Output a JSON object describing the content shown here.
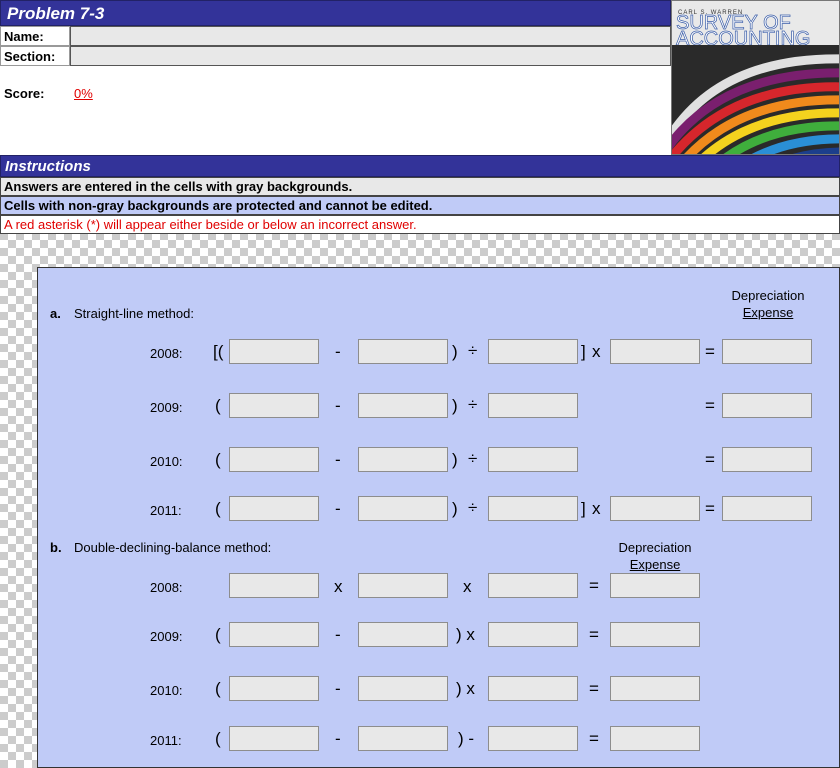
{
  "header": {
    "title": "Problem 7-3",
    "name_label": "Name:",
    "section_label": "Section:",
    "score_label": "Score:",
    "score_value": "0%"
  },
  "book": {
    "author": "CARL S. WARREN",
    "title_line1": "SURVEY OF",
    "title_line2": "ACCOUNTING"
  },
  "instructions": {
    "title": "Instructions",
    "lines": [
      "Answers are entered in the cells with gray backgrounds.",
      "Cells with non-gray backgrounds are protected and cannot be edited.",
      "A red asterisk (*) will appear either beside or below an incorrect answer."
    ]
  },
  "part_a": {
    "letter": "a.",
    "title": "Straight-line method:",
    "header_line1": "Depreciation",
    "header_line2": "Expense",
    "years": [
      "2008:",
      "2009:",
      "2010:",
      "2011:"
    ]
  },
  "part_b": {
    "letter": "b.",
    "title": "Double-declining-balance method:",
    "header_line1": "Depreciation",
    "header_line2": "Expense",
    "years": [
      "2008:",
      "2009:",
      "2010:",
      "2011:"
    ]
  },
  "symbols": {
    "open_bracket_paren": "[(",
    "open_paren": "(",
    "minus": "-",
    "close_paren": ")",
    "divide": "÷",
    "close_bracket": "]",
    "times": "x",
    "equals": "=",
    "close_paren_times": ") x",
    "close_paren_minus": ") -"
  },
  "colors": {
    "header_bar": "#333399",
    "panel": "#c0cbf7",
    "input_gray": "#e8e8e8",
    "error_red": "#e00000"
  }
}
